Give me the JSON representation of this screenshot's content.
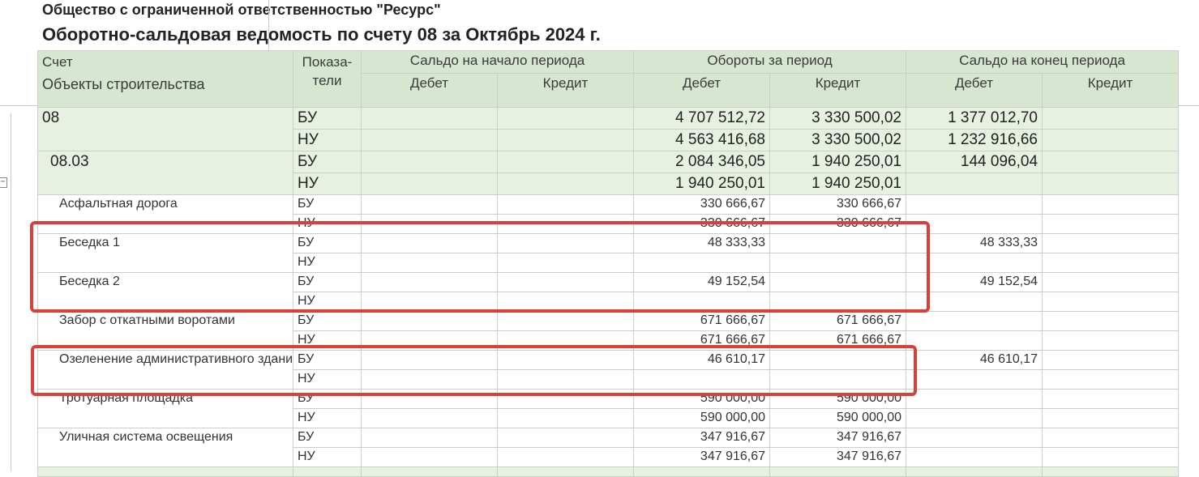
{
  "report": {
    "organization": "Общество с ограниченной ответственностью \"Ресурс\"",
    "title": "Оборотно-сальдовая ведомость по счету 08 за Октябрь 2024 г."
  },
  "columns": {
    "account": "Счет",
    "objects": "Объекты строительства",
    "indicators": "Показа-\nтели",
    "opening_balance": "Сальдо на начало периода",
    "turnover": "Обороты за период",
    "closing_balance": "Сальдо на конец периода",
    "debit": "Дебет",
    "credit": "Кредит"
  },
  "rows": [
    {
      "name": "08",
      "level": "group",
      "lines": [
        {
          "ind": "БУ",
          "od": "",
          "oc": "",
          "td": "4 707 512,72",
          "tc": "3 330 500,02",
          "cd": "1 377 012,70",
          "cc": ""
        },
        {
          "ind": "НУ",
          "od": "",
          "oc": "",
          "td": "4 563 416,68",
          "tc": "3 330 500,02",
          "cd": "1 232 916,66",
          "cc": ""
        }
      ]
    },
    {
      "name": "08.03",
      "level": "group2",
      "lines": [
        {
          "ind": "БУ",
          "od": "",
          "oc": "",
          "td": "2 084 346,05",
          "tc": "1 940 250,01",
          "cd": "144 096,04",
          "cc": ""
        },
        {
          "ind": "НУ",
          "od": "",
          "oc": "",
          "td": "1 940 250,01",
          "tc": "1 940 250,01",
          "cd": "",
          "cc": ""
        }
      ]
    },
    {
      "name": "Асфальтная дорога",
      "level": "detail",
      "lines": [
        {
          "ind": "БУ",
          "od": "",
          "oc": "",
          "td": "330 666,67",
          "tc": "330 666,67",
          "cd": "",
          "cc": ""
        },
        {
          "ind": "НУ",
          "od": "",
          "oc": "",
          "td": "330 666,67",
          "tc": "330 666,67",
          "cd": "",
          "cc": ""
        }
      ]
    },
    {
      "name": "Беседка 1",
      "level": "detail",
      "lines": [
        {
          "ind": "БУ",
          "od": "",
          "oc": "",
          "td": "48 333,33",
          "tc": "",
          "cd": "48 333,33",
          "cc": ""
        },
        {
          "ind": "НУ",
          "od": "",
          "oc": "",
          "td": "",
          "tc": "",
          "cd": "",
          "cc": ""
        }
      ]
    },
    {
      "name": "Беседка 2",
      "level": "detail",
      "lines": [
        {
          "ind": "БУ",
          "od": "",
          "oc": "",
          "td": "49 152,54",
          "tc": "",
          "cd": "49 152,54",
          "cc": ""
        },
        {
          "ind": "НУ",
          "od": "",
          "oc": "",
          "td": "",
          "tc": "",
          "cd": "",
          "cc": ""
        }
      ]
    },
    {
      "name": "Забор с откатными воротами",
      "level": "detail",
      "lines": [
        {
          "ind": "БУ",
          "od": "",
          "oc": "",
          "td": "671 666,67",
          "tc": "671 666,67",
          "cd": "",
          "cc": ""
        },
        {
          "ind": "НУ",
          "od": "",
          "oc": "",
          "td": "671 666,67",
          "tc": "671 666,67",
          "cd": "",
          "cc": ""
        }
      ]
    },
    {
      "name": "Озеленение административного здания",
      "level": "detail",
      "lines": [
        {
          "ind": "БУ",
          "od": "",
          "oc": "",
          "td": "46 610,17",
          "tc": "",
          "cd": "46 610,17",
          "cc": ""
        },
        {
          "ind": "НУ",
          "od": "",
          "oc": "",
          "td": "",
          "tc": "",
          "cd": "",
          "cc": ""
        }
      ]
    },
    {
      "name": "Тротуарная площадка",
      "level": "detail",
      "lines": [
        {
          "ind": "БУ",
          "od": "",
          "oc": "",
          "td": "590 000,00",
          "tc": "590 000,00",
          "cd": "",
          "cc": ""
        },
        {
          "ind": "НУ",
          "od": "",
          "oc": "",
          "td": "590 000,00",
          "tc": "590 000,00",
          "cd": "",
          "cc": ""
        }
      ]
    },
    {
      "name": "Уличная система освещения",
      "level": "detail",
      "lines": [
        {
          "ind": "БУ",
          "od": "",
          "oc": "",
          "td": "347 916,67",
          "tc": "347 916,67",
          "cd": "",
          "cc": ""
        },
        {
          "ind": "НУ",
          "od": "",
          "oc": "",
          "td": "347 916,67",
          "tc": "347 916,67",
          "cd": "",
          "cc": ""
        }
      ]
    }
  ],
  "annotation_color": "#d9403a",
  "header_color": "#d7e6d0",
  "group_row_color": "#e7f1e2"
}
